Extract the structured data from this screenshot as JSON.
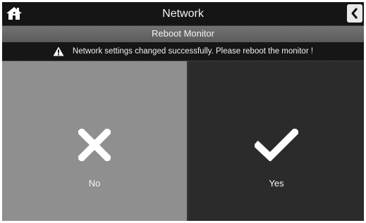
{
  "header": {
    "title": "Network",
    "home_icon": "home-icon",
    "back_icon": "chevron-left-icon"
  },
  "subtitle": "Reboot Monitor",
  "message": {
    "icon": "warning-icon",
    "text": "Network settings changed successfully. Please reboot the monitor !"
  },
  "options": {
    "no": {
      "label": "No",
      "icon": "cross-icon"
    },
    "yes": {
      "label": "Yes",
      "icon": "checkmark-icon"
    }
  },
  "colors": {
    "no_panel": "#8f8f8f",
    "yes_panel": "#2b2b2b",
    "header_bg": "#151515"
  }
}
